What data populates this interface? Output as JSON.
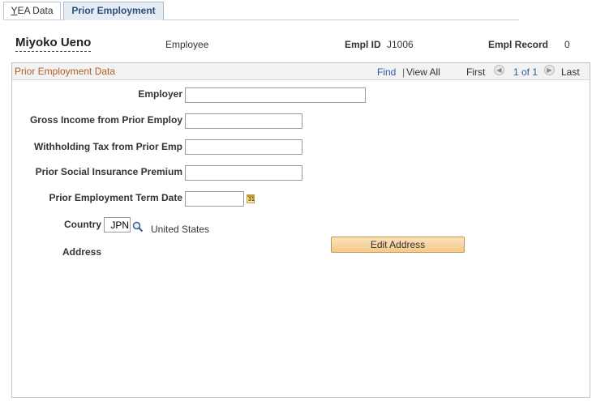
{
  "tabs": [
    {
      "label_prefix": "Y",
      "label_rest": "EA Data"
    },
    {
      "label": "Prior Employment"
    }
  ],
  "header": {
    "employee_name": "Miyoko Ueno",
    "employee_label": "Employee",
    "empl_id_label": "Empl ID",
    "empl_id_value": "J1006",
    "empl_record_label": "Empl Record",
    "empl_record_value": "0"
  },
  "grid": {
    "title": "Prior Employment Data",
    "find": "Find",
    "separator": "|",
    "view_all": "View All",
    "first": "First",
    "position": "1 of 1",
    "last": "Last"
  },
  "form": {
    "employer_label": "Employer",
    "employer_value": "",
    "gross_income_label": "Gross Income from Prior Employ",
    "gross_income_value": "",
    "withholding_label": "Withholding Tax from Prior Emp",
    "withholding_value": "",
    "social_ins_label": "Prior Social Insurance Premium",
    "social_ins_value": "",
    "term_date_label": "Prior Employment Term Date",
    "term_date_value": "",
    "calendar_icon_text": "31",
    "country_label": "Country",
    "country_code": "JPN",
    "country_name": "United States",
    "address_label": "Address",
    "edit_address_button": "Edit Address"
  }
}
